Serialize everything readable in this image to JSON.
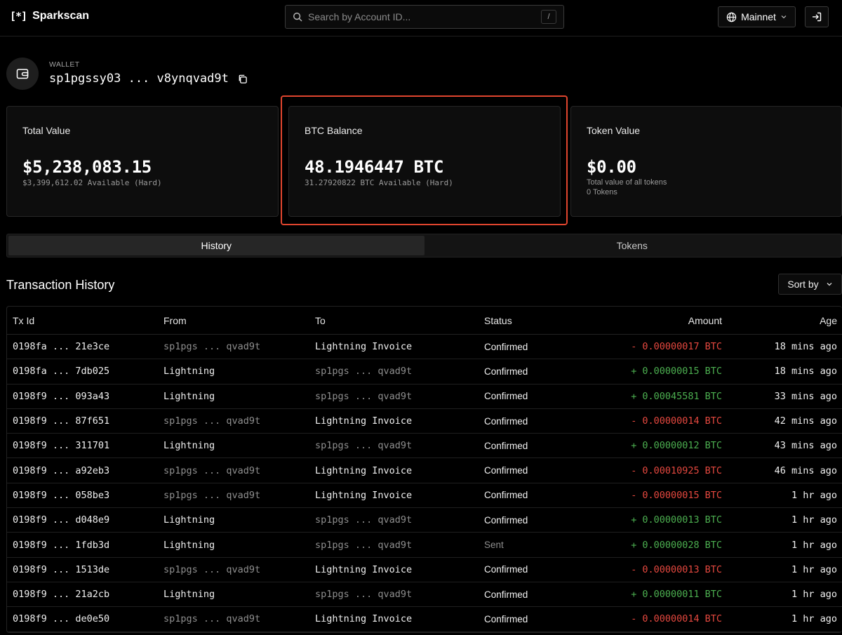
{
  "header": {
    "logo_mark": "[*]",
    "app_name": "Sparkscan",
    "search_placeholder": "Search by Account ID...",
    "search_shortcut": "/",
    "network": "Mainnet"
  },
  "wallet": {
    "label": "WALLET",
    "address": "sp1pgssy03 ... v8ynqvad9t"
  },
  "cards": {
    "total_value": {
      "title": "Total Value",
      "value": "$5,238,083.15",
      "sub": "$3,399,612.02 Available (Hard)"
    },
    "btc_balance": {
      "title": "BTC Balance",
      "value": "48.1946447 BTC",
      "sub": "31.27920822 BTC Available (Hard)"
    },
    "token_value": {
      "title": "Token Value",
      "value": "$0.00",
      "sub": "Total value of all tokens",
      "sub2": "0 Tokens"
    }
  },
  "tabs": [
    {
      "label": "History",
      "active": true
    },
    {
      "label": "Tokens",
      "active": false
    }
  ],
  "transactions": {
    "title": "Transaction History",
    "sort_label": "Sort by",
    "columns": {
      "tx_id": "Tx Id",
      "from": "From",
      "to": "To",
      "status": "Status",
      "amount": "Amount",
      "age": "Age"
    },
    "rows": [
      {
        "tx_id": "0198fa ... 21e3ce",
        "from": "sp1pgs ... qvad9t",
        "to": "Lightning Invoice",
        "status": "Confirmed",
        "sign": "-",
        "amount": "0.00000017",
        "unit": "BTC",
        "age": "18 mins ago"
      },
      {
        "tx_id": "0198fa ... 7db025",
        "from": "Lightning",
        "to": "sp1pgs ... qvad9t",
        "status": "Confirmed",
        "sign": "+",
        "amount": "0.00000015",
        "unit": "BTC",
        "age": "18 mins ago"
      },
      {
        "tx_id": "0198f9 ... 093a43",
        "from": "Lightning",
        "to": "sp1pgs ... qvad9t",
        "status": "Confirmed",
        "sign": "+",
        "amount": "0.00045581",
        "unit": "BTC",
        "age": "33 mins ago"
      },
      {
        "tx_id": "0198f9 ... 87f651",
        "from": "sp1pgs ... qvad9t",
        "to": "Lightning Invoice",
        "status": "Confirmed",
        "sign": "-",
        "amount": "0.00000014",
        "unit": "BTC",
        "age": "42 mins ago"
      },
      {
        "tx_id": "0198f9 ... 311701",
        "from": "Lightning",
        "to": "sp1pgs ... qvad9t",
        "status": "Confirmed",
        "sign": "+",
        "amount": "0.00000012",
        "unit": "BTC",
        "age": "43 mins ago"
      },
      {
        "tx_id": "0198f9 ... a92eb3",
        "from": "sp1pgs ... qvad9t",
        "to": "Lightning Invoice",
        "status": "Confirmed",
        "sign": "-",
        "amount": "0.00010925",
        "unit": "BTC",
        "age": "46 mins ago"
      },
      {
        "tx_id": "0198f9 ... 058be3",
        "from": "sp1pgs ... qvad9t",
        "to": "Lightning Invoice",
        "status": "Confirmed",
        "sign": "-",
        "amount": "0.00000015",
        "unit": "BTC",
        "age": "1 hr ago"
      },
      {
        "tx_id": "0198f9 ... d048e9",
        "from": "Lightning",
        "to": "sp1pgs ... qvad9t",
        "status": "Confirmed",
        "sign": "+",
        "amount": "0.00000013",
        "unit": "BTC",
        "age": "1 hr ago"
      },
      {
        "tx_id": "0198f9 ... 1fdb3d",
        "from": "Lightning",
        "to": "sp1pgs ... qvad9t",
        "status": "Sent",
        "sign": "+",
        "amount": "0.00000028",
        "unit": "BTC",
        "age": "1 hr ago"
      },
      {
        "tx_id": "0198f9 ... 1513de",
        "from": "sp1pgs ... qvad9t",
        "to": "Lightning Invoice",
        "status": "Confirmed",
        "sign": "-",
        "amount": "0.00000013",
        "unit": "BTC",
        "age": "1 hr ago"
      },
      {
        "tx_id": "0198f9 ... 21a2cb",
        "from": "Lightning",
        "to": "sp1pgs ... qvad9t",
        "status": "Confirmed",
        "sign": "+",
        "amount": "0.00000011",
        "unit": "BTC",
        "age": "1 hr ago"
      },
      {
        "tx_id": "0198f9 ... de0e50",
        "from": "sp1pgs ... qvad9t",
        "to": "Lightning Invoice",
        "status": "Confirmed",
        "sign": "-",
        "amount": "0.00000014",
        "unit": "BTC",
        "age": "1 hr ago"
      }
    ]
  },
  "colors": {
    "background": "#000000",
    "positive": "#4caf50",
    "negative": "#e5483f",
    "highlight": "#e0452e"
  }
}
